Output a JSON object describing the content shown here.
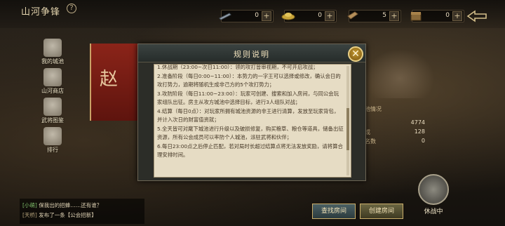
{
  "header": {
    "title": "山河争锋",
    "help_label": "?"
  },
  "resources": [
    {
      "icon": "sword-icon",
      "value": "0"
    },
    {
      "icon": "gold-ingot-icon",
      "value": "0"
    },
    {
      "icon": "token-icon",
      "value": "5"
    },
    {
      "icon": "treasure-chest-icon",
      "value": "0"
    }
  ],
  "menu": [
    {
      "label": "我的城池",
      "icon": "castle-icon"
    },
    {
      "label": "山河商店",
      "icon": "shop-icon"
    },
    {
      "label": "武将图鉴",
      "icon": "book-icon"
    },
    {
      "label": "排行",
      "icon": "ranking-icon"
    }
  ],
  "banner": {
    "character": "赵"
  },
  "dialog": {
    "title": "规则说明",
    "close_label": "✕",
    "rules": [
      "1.休战期（23:00~次日11:00）：领的攻打皆审视期，不可开启攻战；",
      "2.准备阶段（每日0:00~11:00）：本势力的一字王可以选择或修改，确认会日的攻打势力，逾期将随机生成非己方的5个攻打势力；",
      "3.攻防阶段（每日11:00~23:00）：玩家可创建、搜索和加入房间，与同公会玩家组队出征。房主从攻方城池中选择目标，进行3人组队对战；",
      "4.结算（每日0点）：对玩家所拥有城池资源的非王进行清算，发放至玩家背包，并计入次日的财富值资就；",
      "5.全天皆可对麾下城池进行升级以及破损修复，购买粮草、粮仓等道具，储备出征资源，所有公会成员可以率防个人城池，派驻武将和伙伴；",
      "6.每日23:00点之后停止匹配，若对局时长超过结算点将无法发放奖励，请将算合理安排时间。"
    ]
  },
  "right_panel": {
    "title": "池情况",
    "rows": [
      {
        "label": "",
        "value": "4774"
      },
      {
        "label": "成",
        "value": "128"
      },
      {
        "label": "名数",
        "value": "0"
      }
    ]
  },
  "chat": [
    {
      "tag": "[小萌]",
      "text": "保我出的招蜂……还有谁？"
    },
    {
      "tag": "[天桥]",
      "text": "发布了一条【公会招新】"
    }
  ],
  "buttons": {
    "find_room": "查找房间",
    "create_room": "创建房间"
  },
  "status": {
    "label": "休战中"
  }
}
